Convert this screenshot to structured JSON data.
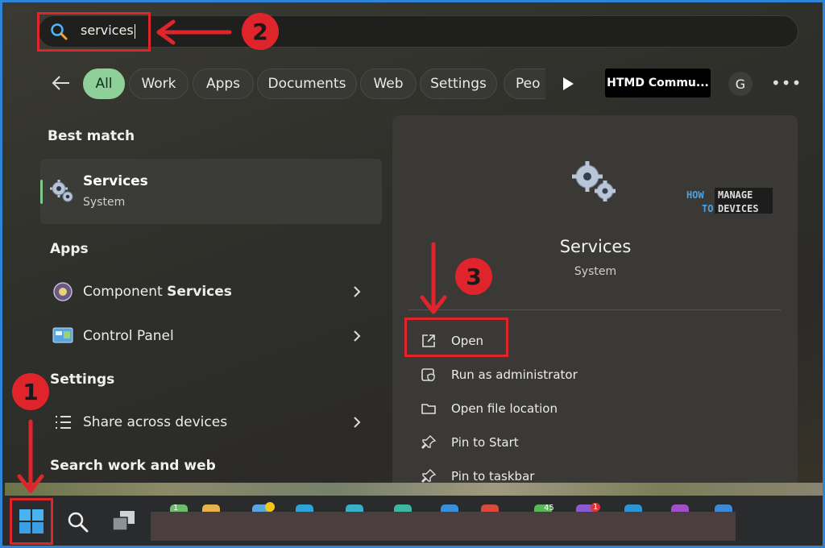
{
  "search": {
    "query": "services"
  },
  "filters": {
    "chips": [
      "All",
      "Work",
      "Apps",
      "Documents",
      "Web",
      "Settings",
      "Peo"
    ],
    "htmd_chip": "HTMD Commu...",
    "avatar_letter": "G",
    "more": "•••"
  },
  "left": {
    "best_match_heading": "Best match",
    "best_match": {
      "title": "Services",
      "subtitle": "System"
    },
    "apps_heading": "Apps",
    "apps": [
      {
        "prefix": "Component ",
        "bold": "Services"
      },
      {
        "label": "Control Panel"
      }
    ],
    "settings_heading": "Settings",
    "settings": [
      {
        "label": "Share across devices"
      }
    ],
    "search_web_heading": "Search work and web"
  },
  "right": {
    "title": "Services",
    "subtitle": "System",
    "actions": [
      "Open",
      "Run as administrator",
      "Open file location",
      "Pin to Start",
      "Pin to taskbar"
    ]
  },
  "watermark": {
    "line1_a": "HOW",
    "line1_b": "MANAGE",
    "line2_a": "TO",
    "line2_b": "DEVICES"
  },
  "annotations": {
    "step1": "1",
    "step2": "2",
    "step3": "3"
  },
  "taskbar": {
    "badges": [
      "1",
      "45",
      "1"
    ]
  },
  "colors": {
    "accent_green": "#8fcf9a",
    "annotation_red": "#e0242c",
    "frame_blue": "#2f84d8"
  }
}
